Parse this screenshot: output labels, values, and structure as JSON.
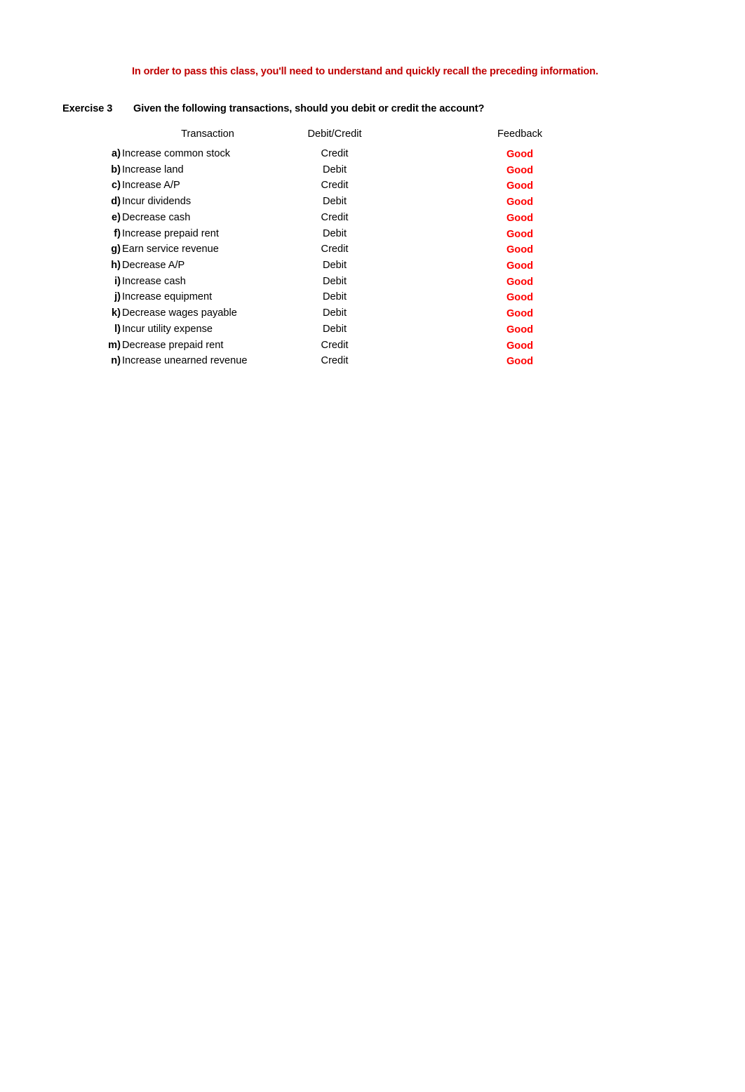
{
  "document": {
    "banner_note": "In order to pass this class, you'll need to understand and quickly recall the preceding information.",
    "banner_color": "#C00000",
    "feedback_color": "#FF0000",
    "background_color": "#FFFFFF",
    "text_color": "#000000"
  },
  "exercise": {
    "label": "Exercise 3",
    "prompt": "Given the following transactions, should you debit or credit the account?"
  },
  "table": {
    "headers": {
      "transaction": "Transaction",
      "debit_credit": "Debit/Credit",
      "feedback": "Feedback"
    },
    "rows": [
      {
        "letter": "a)",
        "transaction": "Increase common stock",
        "debit_credit": "Credit",
        "feedback": "Good"
      },
      {
        "letter": "b)",
        "transaction": "Increase land",
        "debit_credit": "Debit",
        "feedback": "Good"
      },
      {
        "letter": "c)",
        "transaction": "Increase A/P",
        "debit_credit": "Credit",
        "feedback": "Good"
      },
      {
        "letter": "d)",
        "transaction": "Incur dividends",
        "debit_credit": "Debit",
        "feedback": "Good"
      },
      {
        "letter": "e)",
        "transaction": "Decrease cash",
        "debit_credit": "Credit",
        "feedback": "Good"
      },
      {
        "letter": "f)",
        "transaction": "Increase prepaid rent",
        "debit_credit": "Debit",
        "feedback": "Good"
      },
      {
        "letter": "g)",
        "transaction": "Earn service revenue",
        "debit_credit": "Credit",
        "feedback": "Good"
      },
      {
        "letter": "h)",
        "transaction": "Decrease A/P",
        "debit_credit": "Debit",
        "feedback": "Good"
      },
      {
        "letter": "i)",
        "transaction": "Increase cash",
        "debit_credit": "Debit",
        "feedback": "Good"
      },
      {
        "letter": "j)",
        "transaction": "Increase equipment",
        "debit_credit": "Debit",
        "feedback": "Good"
      },
      {
        "letter": "k)",
        "transaction": "Decrease wages payable",
        "debit_credit": "Debit",
        "feedback": "Good"
      },
      {
        "letter": "l)",
        "transaction": "Incur utility expense",
        "debit_credit": "Debit",
        "feedback": "Good"
      },
      {
        "letter": "m)",
        "transaction": "Decrease prepaid rent",
        "debit_credit": "Credit",
        "feedback": "Good"
      },
      {
        "letter": "n)",
        "transaction": "Increase unearned revenue",
        "debit_credit": "Credit",
        "feedback": "Good"
      }
    ]
  }
}
